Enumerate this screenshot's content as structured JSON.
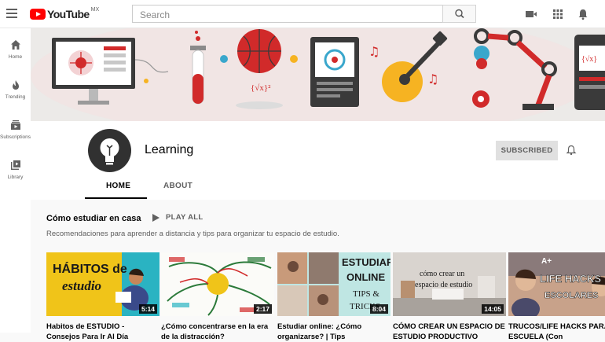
{
  "topbar": {
    "logo_text": "YouTube",
    "logo_country": "MX",
    "search_placeholder": "Search"
  },
  "sidebar": {
    "items": [
      {
        "label": "Home",
        "icon": "home-icon"
      },
      {
        "label": "Trending",
        "icon": "flame-icon"
      },
      {
        "label": "Subscriptions",
        "icon": "subscriptions-icon"
      },
      {
        "label": "Library",
        "icon": "library-icon"
      }
    ]
  },
  "channel": {
    "name": "Learning",
    "subscribe_label": "SUBSCRIBED"
  },
  "tabs": [
    {
      "label": "HOME",
      "active": true
    },
    {
      "label": "ABOUT",
      "active": false
    }
  ],
  "shelf": {
    "title": "Cómo estudiar en casa",
    "play_all_label": "PLAY ALL",
    "description": "Recomendaciones para aprender a distancia y tips para organizar tu espacio de estudio."
  },
  "videos": [
    {
      "title": "Habitos de ESTUDIO - Consejos Para Ir Al Día",
      "duration": "5:14",
      "thumb_text": "HÁBITOS de estudio"
    },
    {
      "title": "¿Cómo concentrarse en la era de la distracción?",
      "duration": "2:17",
      "thumb_text": ""
    },
    {
      "title": "Estudiar online: ¿Cómo organizarse? | Tips",
      "duration": "8:04",
      "thumb_text": "ESTUDIAR ONLINE TIPS & TRICKS"
    },
    {
      "title": "CÓMO CREAR UN ESPACIO DE ESTUDIO PRODUCTIVO",
      "duration": "14:05",
      "thumb_text": "cómo crear un espacio de estudio"
    },
    {
      "title": "TRUCOS/LIFE HACKS PARA LA ESCUELA (Con",
      "duration": "",
      "thumb_text": "LIFE HACKS ESCOLARES"
    }
  ],
  "colors": {
    "brand_red": "#ff0000",
    "banner_bg": "#eceae8"
  }
}
